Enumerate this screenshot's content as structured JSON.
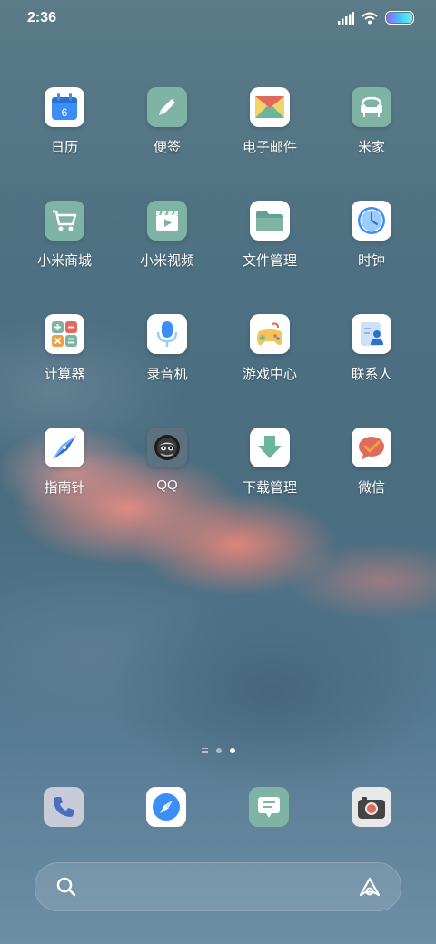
{
  "status_bar": {
    "time": "2:36"
  },
  "apps": [
    {
      "label": "日历",
      "icon": "calendar-icon",
      "day": "6"
    },
    {
      "label": "便签",
      "icon": "notes-icon"
    },
    {
      "label": "电子邮件",
      "icon": "email-icon"
    },
    {
      "label": "米家",
      "icon": "mijia-icon"
    },
    {
      "label": "小米商城",
      "icon": "shopping-cart-icon"
    },
    {
      "label": "小米视频",
      "icon": "video-icon"
    },
    {
      "label": "文件管理",
      "icon": "folder-icon"
    },
    {
      "label": "时钟",
      "icon": "clock-icon"
    },
    {
      "label": "计算器",
      "icon": "calculator-icon"
    },
    {
      "label": "录音机",
      "icon": "microphone-icon"
    },
    {
      "label": "游戏中心",
      "icon": "gamepad-icon"
    },
    {
      "label": "联系人",
      "icon": "contacts-icon"
    },
    {
      "label": "指南针",
      "icon": "compass-icon"
    },
    {
      "label": "QQ",
      "icon": "qq-icon"
    },
    {
      "label": "下载管理",
      "icon": "download-icon"
    },
    {
      "label": "微信",
      "icon": "wechat-icon"
    }
  ],
  "dock": [
    {
      "icon": "phone-icon"
    },
    {
      "icon": "browser-icon"
    },
    {
      "icon": "messages-icon"
    },
    {
      "icon": "camera-icon"
    }
  ],
  "colors": {
    "accent_green": "#7fb3a3",
    "accent_blue": "#3a8ef6",
    "accent_orange": "#f0a040"
  }
}
